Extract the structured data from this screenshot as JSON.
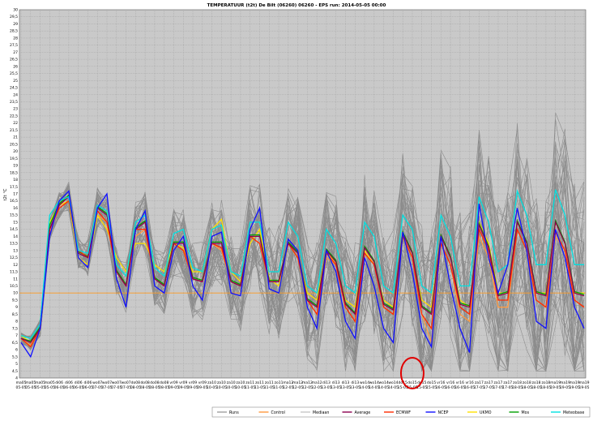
{
  "chart_data": {
    "type": "line",
    "title": "TEMPERATUUR (t2t) De Bilt (06260) 06260 - EPS run: 2014-05-05 00:00",
    "ylabel": "t2t °C",
    "ylim": [
      4,
      30
    ],
    "ytick_step": 0.5,
    "threshold": 10,
    "x": [
      "ma05",
      "di06",
      "wo07",
      "do08",
      "vr09",
      "za10",
      "zo11",
      "ma12",
      "di13",
      "wo14",
      "do15",
      "vr16",
      "za17",
      "zo18",
      "ma19"
    ],
    "xtick_labels": [
      "ma05",
      "ma05",
      "ma05",
      "ma05",
      "di06",
      "di06",
      "di06",
      "di06",
      "wo07",
      "wo07",
      "wo07",
      "wo07",
      "do08",
      "do08",
      "do08",
      "do08",
      "vr09",
      "vr09",
      "vr09",
      "vr09",
      "za10",
      "za10",
      "za10",
      "za10",
      "zo11",
      "zo11",
      "zo11",
      "zo11",
      "ma12",
      "ma12",
      "ma12",
      "ma12",
      "di13",
      "di13",
      "di13",
      "di13",
      "wo14",
      "wo14",
      "wo14",
      "wo14",
      "do15",
      "do15",
      "do15",
      "do15",
      "vr16",
      "vr16",
      "vr16",
      "vr16",
      "za17",
      "za17",
      "za17",
      "za17",
      "zo18",
      "zo18",
      "zo18",
      "zo18",
      "ma19",
      "ma19",
      "ma19",
      "ma19"
    ],
    "xtick_dates": [
      "05-05",
      "05-05",
      "05-05",
      "05-05",
      "06-05",
      "06-05",
      "06-05",
      "06-05",
      "07-05",
      "07-05",
      "07-05",
      "07-05",
      "08-05",
      "08-05",
      "08-05",
      "08-05",
      "09-05",
      "09-05",
      "09-05",
      "09-05",
      "10-05",
      "10-05",
      "10-05",
      "10-05",
      "11-05",
      "11-05",
      "11-05",
      "11-05",
      "12-05",
      "12-05",
      "12-05",
      "12-05",
      "13-05",
      "13-05",
      "13-05",
      "13-05",
      "14-05",
      "14-05",
      "14-05",
      "14-05",
      "15-05",
      "15-05",
      "15-05",
      "15-05",
      "16-05",
      "16-05",
      "16-05",
      "16-05",
      "17-05",
      "17-05",
      "17-05",
      "17-05",
      "18-05",
      "18-05",
      "18-05",
      "18-05",
      "19-05",
      "19-05",
      "19-05",
      "19-05"
    ],
    "series": [
      {
        "name": "NCEP",
        "color": "#1010ff",
        "values": [
          6.5,
          5.5,
          7.5,
          14,
          16.5,
          17.2,
          12.5,
          11.8,
          16,
          17,
          11,
          9,
          14.5,
          15.8,
          10.5,
          10,
          13,
          14,
          10.5,
          9.5,
          14,
          14.3,
          10,
          9.8,
          14.5,
          16,
          10.3,
          10,
          13.8,
          13,
          9,
          7.5,
          13,
          11.5,
          8,
          6.8,
          12.5,
          10.5,
          7.5,
          6.5,
          14.3,
          11.5,
          7.5,
          6.2,
          14,
          10.5,
          7.5,
          5.8,
          16.3,
          12.5,
          10,
          12,
          16,
          13,
          8,
          7.5,
          14.5,
          12.5,
          9,
          7.5
        ]
      },
      {
        "name": "ECMWF",
        "color": "#ff2a00",
        "values": [
          6.8,
          6.2,
          7.5,
          14.5,
          16,
          16.5,
          13,
          12.5,
          15.8,
          15,
          11.5,
          10.5,
          14.5,
          14.5,
          11,
          10.5,
          13.5,
          13,
          11,
          10.8,
          13.5,
          13.2,
          10.8,
          10.5,
          14,
          13.5,
          10.8,
          10.8,
          13.5,
          12.5,
          9.5,
          8.5,
          12.8,
          12,
          9,
          8,
          12.8,
          12,
          9,
          8.5,
          14,
          12.5,
          8.5,
          7.5,
          13.5,
          12,
          9,
          8.5,
          14.5,
          13,
          9.5,
          9.5,
          14.5,
          13,
          9.5,
          9,
          14.3,
          13,
          9.5,
          9
        ]
      },
      {
        "name": "Average",
        "color": "#8b0050",
        "values": [
          6.8,
          6.5,
          7.5,
          14.5,
          16.2,
          16.8,
          12.8,
          12.5,
          16,
          15.5,
          11.5,
          10.5,
          14.5,
          15,
          11,
          10.5,
          13.5,
          13.5,
          11,
          10.8,
          13.5,
          13.5,
          10.8,
          10.5,
          14,
          14,
          10.8,
          10.8,
          13.5,
          12.8,
          9.5,
          9,
          13,
          12.2,
          9.2,
          8.5,
          13.2,
          12.2,
          9.2,
          8.8,
          14.2,
          12.8,
          9,
          8.5,
          14,
          12.5,
          9.2,
          9,
          14.8,
          13.2,
          9.8,
          10,
          15,
          13.5,
          10,
          9.8,
          15,
          13.5,
          10,
          9.8
        ]
      },
      {
        "name": "Mos",
        "color": "#00a000",
        "values": [
          6.8,
          6.6,
          7.6,
          14.8,
          16.3,
          16.9,
          12.9,
          12.6,
          16.1,
          15.6,
          11.6,
          10.6,
          14.6,
          15.1,
          11.1,
          10.6,
          13.6,
          13.6,
          11.1,
          10.9,
          13.6,
          13.6,
          10.9,
          10.6,
          14.1,
          14.1,
          10.9,
          10.9,
          13.6,
          12.9,
          9.6,
          9.1,
          13.1,
          12.3,
          9.3,
          8.6,
          13.3,
          12.3,
          9.3,
          8.9,
          14.3,
          12.9,
          9.1,
          8.6,
          14.1,
          12.6,
          9.3,
          9.1,
          14.9,
          13.3,
          9.9,
          10.1,
          15.1,
          13.6,
          10.1,
          9.9,
          15.1,
          13.6,
          10.1,
          9.9
        ]
      },
      {
        "name": "UKMO",
        "color": "#ffe000",
        "values": [
          7,
          6.5,
          7.5,
          15,
          16.2,
          16.5,
          12.5,
          12,
          15.5,
          14.5,
          12.5,
          11.5,
          13.5,
          13.5,
          12,
          11.5,
          13.5,
          13.2,
          11.5,
          11.5,
          14.5,
          15.2,
          11.5,
          10.8,
          13.5,
          14.5,
          11,
          10.5,
          13.5,
          12.5,
          10,
          9.5,
          13,
          12,
          9.5,
          9,
          13,
          12,
          9.5,
          9,
          14,
          12.5,
          9.5,
          9,
          14,
          12.5,
          9.5,
          9,
          15,
          13.5,
          10,
          10,
          15,
          13.5,
          10,
          10,
          15,
          13.5,
          10,
          10
        ]
      },
      {
        "name": "Meteobase",
        "color": "#00e0e0",
        "values": [
          7,
          6.8,
          7.8,
          15.5,
          16.5,
          16.8,
          13,
          12.8,
          16.2,
          15.8,
          12,
          11.2,
          15,
          15.5,
          11.8,
          11.2,
          14.2,
          14.5,
          11.8,
          11.5,
          14.5,
          14.8,
          11.5,
          11.2,
          15,
          15,
          11.5,
          11.5,
          15,
          14,
          10.5,
          10,
          14.5,
          13.5,
          10.5,
          10,
          15,
          14,
          10.5,
          10,
          15.5,
          14.5,
          10.5,
          10,
          15.5,
          14,
          10.5,
          10.5,
          16.8,
          15,
          11.5,
          12,
          17.2,
          15.5,
          12,
          12,
          17.3,
          15.5,
          12,
          12
        ]
      },
      {
        "name": "Control",
        "color": "#ff9a40",
        "values": [
          6.8,
          6.3,
          7.5,
          14.3,
          16,
          16.5,
          13,
          12.5,
          15.5,
          15,
          11.5,
          10.5,
          14,
          14.5,
          11,
          10.5,
          13.5,
          13,
          11,
          10.8,
          13.5,
          13,
          10.8,
          10.5,
          14,
          13.5,
          10.8,
          10.8,
          13.5,
          12.5,
          9.5,
          8.5,
          12.5,
          12,
          9,
          8,
          13,
          12,
          9,
          8.5,
          14,
          12.5,
          8.5,
          6.5,
          13.5,
          12,
          8.5,
          8,
          14,
          12.5,
          9,
          9,
          14.5,
          13,
          9.5,
          9,
          14,
          13,
          9.5,
          9
        ]
      },
      {
        "name": "Mediaan",
        "color": "#c8c8c8",
        "values": [
          6.8,
          6.5,
          7.5,
          14.5,
          16,
          16.8,
          12.8,
          12.5,
          16,
          15.5,
          11.5,
          10.5,
          14.5,
          15,
          11,
          10.5,
          13.5,
          13.5,
          11,
          10.8,
          13.5,
          13.5,
          10.8,
          10.5,
          14,
          14,
          10.8,
          10.8,
          13.5,
          12.8,
          9.5,
          9,
          13,
          12.2,
          9.2,
          8.5,
          13.2,
          12.2,
          9.2,
          8.8,
          14.2,
          12.8,
          9,
          8.5,
          14,
          12.5,
          9.2,
          9,
          14.8,
          13.2,
          9.8,
          10,
          15,
          13.5,
          10,
          9.8,
          15,
          13.5,
          10,
          9.8
        ]
      }
    ],
    "legend": [
      "Runs",
      "Control",
      "Mediaan",
      "Average",
      "ECMWF",
      "NCEP",
      "UKMO",
      "Mos",
      "Meteobase"
    ],
    "legend_colors": {
      "Runs": "#a0a0a0",
      "Control": "#ff9a40",
      "Mediaan": "#c8c8c8",
      "Average": "#8b0050",
      "ECMWF": "#ff2a00",
      "NCEP": "#1010ff",
      "UKMO": "#ffe000",
      "Mos": "#00a000",
      "Meteobase": "#00e0e0"
    },
    "legend_position": "bottom",
    "grid": true,
    "annotation": {
      "type": "circle",
      "color": "#e00000",
      "target_x": "do15"
    }
  }
}
